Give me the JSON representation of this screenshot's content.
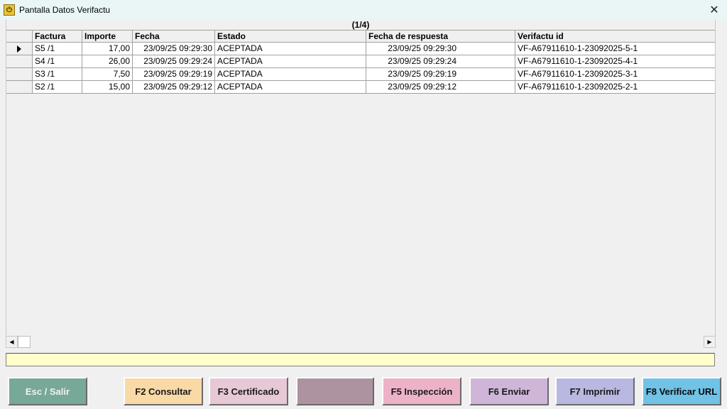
{
  "window": {
    "title": "Pantalla Datos Verifactu",
    "close_glyph": "✕",
    "icon": "app-power-icon"
  },
  "grid": {
    "caption": "(1/4)",
    "columns": [
      "Factura",
      "Importe",
      "Fecha",
      "Estado",
      "Fecha de respuesta",
      "Verifactu id"
    ],
    "rows": [
      {
        "factura": "S5 /1",
        "importe": "17,00",
        "fecha": "23/09/25 09:29:30",
        "estado": "ACEPTADA",
        "fecha_respuesta": "23/09/25 09:29:30",
        "verifactu_id": "VF-A67911610-1-23092025-5-1",
        "current": true
      },
      {
        "factura": "S4 /1",
        "importe": "26,00",
        "fecha": "23/09/25 09:29:24",
        "estado": "ACEPTADA",
        "fecha_respuesta": "23/09/25 09:29:24",
        "verifactu_id": "VF-A67911610-1-23092025-4-1",
        "current": false
      },
      {
        "factura": "S3 /1",
        "importe": "7,50",
        "fecha": "23/09/25 09:29:19",
        "estado": "ACEPTADA",
        "fecha_respuesta": "23/09/25 09:29:19",
        "verifactu_id": "VF-A67911610-1-23092025-3-1",
        "current": false
      },
      {
        "factura": "S2 /1",
        "importe": "15,00",
        "fecha": "23/09/25 09:29:12",
        "estado": "ACEPTADA",
        "fecha_respuesta": "23/09/25 09:29:12",
        "verifactu_id": "VF-A67911610-1-23092025-2-1",
        "current": false
      }
    ]
  },
  "scrollbar": {
    "left_glyph": "◀",
    "right_glyph": "▶"
  },
  "status": {
    "message": ""
  },
  "buttons": {
    "esc": "Esc / Salir",
    "f2": "F2 Consultar",
    "f3": "F3 Certificado",
    "f4": "",
    "f5": "F5 Inspección",
    "f6": "F6 Enviar",
    "f7": "F7 Imprimir",
    "f8": "F8 Verificar URL"
  },
  "colors": {
    "status_bar": "#ffffcc",
    "esc_button": "#78a898",
    "f2_button": "#f9d9a6",
    "f3_button": "#e6c8d6",
    "f4_button": "#ad939f",
    "f5_button": "#eeb2c8",
    "f6_button": "#cfb6d9",
    "f7_button": "#b8b8e0",
    "f8_button": "#70c2e6"
  }
}
